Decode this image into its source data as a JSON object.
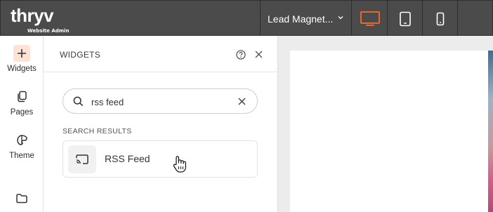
{
  "brand": {
    "name": "thryv",
    "subtitle": "Website Admin"
  },
  "header": {
    "page_selector": "Lead Magnet...",
    "devices": [
      "desktop",
      "tablet",
      "mobile"
    ],
    "active_device": "desktop",
    "accent": "#e8672c"
  },
  "rail": {
    "items": [
      {
        "label": "Widgets",
        "icon": "plus-icon"
      },
      {
        "label": "Pages",
        "icon": "pages-icon"
      },
      {
        "label": "Theme",
        "icon": "theme-icon"
      },
      {
        "label": "",
        "icon": "folder-icon"
      }
    ]
  },
  "panel": {
    "title": "WIDGETS",
    "search": {
      "value": "rss feed",
      "placeholder": ""
    },
    "results_label": "SEARCH RESULTS",
    "results": [
      {
        "label": "RSS Feed",
        "icon": "rss-cast-icon"
      }
    ]
  }
}
